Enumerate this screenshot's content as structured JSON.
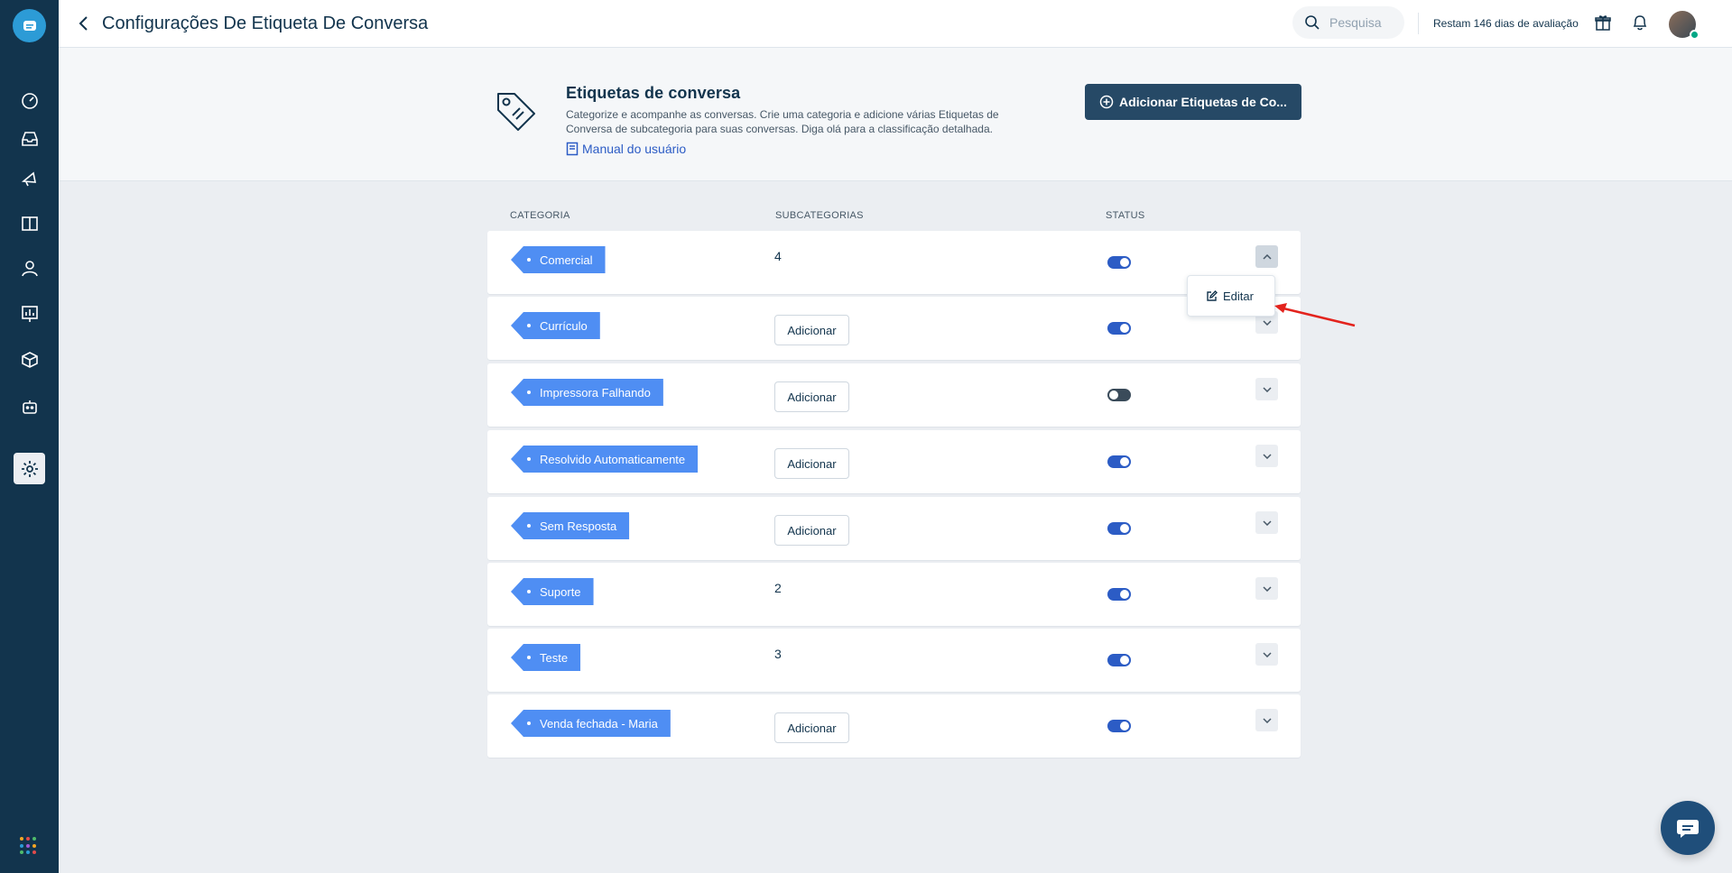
{
  "topbar": {
    "title": "Configurações De Etiqueta De Conversa",
    "search_placeholder": "Pesquisa",
    "trial_text": "Restam 146 dias de avaliação"
  },
  "header": {
    "title": "Etiquetas de conversa",
    "description": "Categorize e acompanhe as conversas. Crie uma categoria e adicione várias Etiquetas de Conversa de subcategoria para suas conversas. Diga olá para a classificação detalhada.",
    "manual_link": "Manual do usuário",
    "add_button": "Adicionar Etiquetas de Co..."
  },
  "table": {
    "columns": [
      "CATEGORIA",
      "SUBCATEGORIAS",
      "STATUS"
    ],
    "rows": [
      {
        "category": "Comercial",
        "subcategories": "4",
        "status": "on",
        "expanded": true
      },
      {
        "category": "Currículo",
        "subcategories": "Adicionar",
        "status": "on"
      },
      {
        "category": "Impressora Falhando",
        "subcategories": "Adicionar",
        "status": "off"
      },
      {
        "category": "Resolvido Automaticamente",
        "subcategories": "Adicionar",
        "status": "on"
      },
      {
        "category": "Sem Resposta",
        "subcategories": "Adicionar",
        "status": "on"
      },
      {
        "category": "Suporte",
        "subcategories": "2",
        "status": "on"
      },
      {
        "category": "Teste",
        "subcategories": "3",
        "status": "on"
      },
      {
        "category": "Venda fechada - Maria",
        "subcategories": "Adicionar",
        "status": "on"
      }
    ]
  },
  "dropdown": {
    "edit_label": "Editar"
  },
  "colors": {
    "sidebar": "#12344d",
    "tag": "#4f8ef3",
    "toggle_on": "#2c5cc5",
    "toggle_off": "#3a4b5a",
    "primary_button": "#264966",
    "annotation_arrow": "#e3231d"
  },
  "icons": [
    "chat-logo-icon",
    "dashboard-icon",
    "inbox-icon",
    "campaign-icon",
    "book-icon",
    "contact-icon",
    "reports-icon",
    "box-icon",
    "bot-icon",
    "settings-icon",
    "apps-grid-icon",
    "back-arrow-icon",
    "search-icon",
    "gift-icon",
    "bell-icon",
    "tag-icon",
    "manual-book-icon",
    "add-circle-icon",
    "chevron-up-icon",
    "chevron-down-icon",
    "edit-icon",
    "chat-fab-icon"
  ]
}
